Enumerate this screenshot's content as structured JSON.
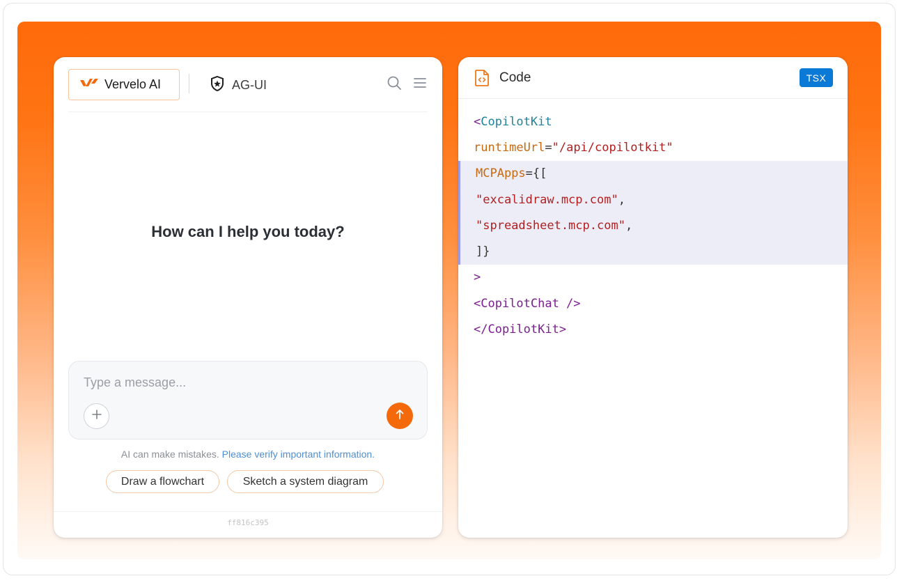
{
  "colors": {
    "accent": "#f46a0a",
    "link": "#4f8fd1",
    "badge": "#0b7ad6",
    "highlight": "#ededf8"
  },
  "chat": {
    "brand": {
      "label": "Vervelo AI",
      "icon": "vervelo-logo-icon"
    },
    "secondary_brand": {
      "label": "AG-UI",
      "icon": "shield-star-icon"
    },
    "header_icons": [
      "search-icon",
      "menu-icon"
    ],
    "greeting": "How can I help you today?",
    "composer": {
      "placeholder": "Type a message...",
      "value": "",
      "attach_icon": "plus-icon",
      "send_icon": "arrow-up-icon"
    },
    "disclaimer": {
      "text": "AI can make mistakes.",
      "link": "Please verify important information."
    },
    "suggestions": [
      "Draw a flowchart",
      "Sketch a system diagram"
    ],
    "build_hash": "ff816c395"
  },
  "code_panel": {
    "title": "Code",
    "icon": "code-file-icon",
    "language_badge": "TSX",
    "lines": [
      {
        "text": "<CopilotKit",
        "highlighted": false
      },
      {
        "text": "runtimeUrl=\"/api/copilotkit\"",
        "highlighted": false
      },
      {
        "text": "MCPApps={[",
        "highlighted": true
      },
      {
        "text": "\"excalidraw.mcp.com\",",
        "highlighted": true
      },
      {
        "text": "\"spreadsheet.mcp.com\",",
        "highlighted": true
      },
      {
        "text": "]}",
        "highlighted": true
      },
      {
        "text": ">",
        "highlighted": false
      },
      {
        "text": "<CopilotChat />",
        "highlighted": false
      },
      {
        "text": "</CopilotKit>",
        "highlighted": false
      }
    ],
    "tokens": {
      "l0_open": "<",
      "l0_name": "CopilotKit",
      "l1_attr": "runtimeUrl",
      "l1_eq": "=",
      "l1_val": "\"/api/copilotkit\"",
      "l2_attr": "MCPApps",
      "l2_rest": "={[",
      "l3_val": "\"excalidraw.mcp.com\"",
      "l3_comma": ",",
      "l4_val": "\"spreadsheet.mcp.com\"",
      "l4_comma": ",",
      "l5_close": "]}",
      "l6_gt": ">",
      "l7_tag": "<CopilotChat />",
      "l8_tag": "</CopilotKit>"
    }
  }
}
